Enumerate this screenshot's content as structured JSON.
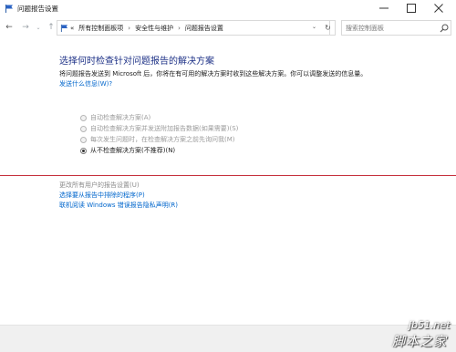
{
  "window": {
    "title": "问题报告设置",
    "minimize": "—",
    "maximize": "☐",
    "close": "✕"
  },
  "nav": {
    "back": "←",
    "forward": "→",
    "history": "⌄",
    "up": "↑"
  },
  "address": {
    "prefix": "«",
    "crumbs": [
      "所有控制面板项",
      "安全性与维护",
      "问题报告设置"
    ],
    "separator": "›",
    "dropdown": "⌄",
    "refresh": "↻"
  },
  "search": {
    "placeholder": "搜索控制面板"
  },
  "main": {
    "heading": "选择何时检查针对问题报告的解决方案",
    "description": "将问题报告发送到 Microsoft 后，你将在有可用的解决方案时收到这些解决方案。你可以调整发送的信息量。",
    "what_sent_link": "发送什么信息(W)?",
    "options": [
      {
        "label": "自动检查解决方案(A)",
        "checked": false,
        "enabled": false
      },
      {
        "label": "自动检查解决方案并发送附加报告数据(如果需要)(S)",
        "checked": false,
        "enabled": false
      },
      {
        "label": "每次发生问题时，在检查解决方案之前先询问我(M)",
        "checked": false,
        "enabled": false
      },
      {
        "label": "从不检查解决方案(不推荐)(N)",
        "checked": true,
        "enabled": true
      }
    ]
  },
  "links": {
    "all_users": "更改所有用户的报告设置(U)",
    "exclude": "选择要从报告中排除的程序(P)",
    "privacy": "联机阅读 Windows 错误报告隐私声明(R)"
  },
  "watermark": {
    "site": "jb51.net",
    "name": "脚本之家"
  },
  "colors": {
    "heading": "#1e3287",
    "link": "#0066cc",
    "divider": "#c6313d"
  }
}
